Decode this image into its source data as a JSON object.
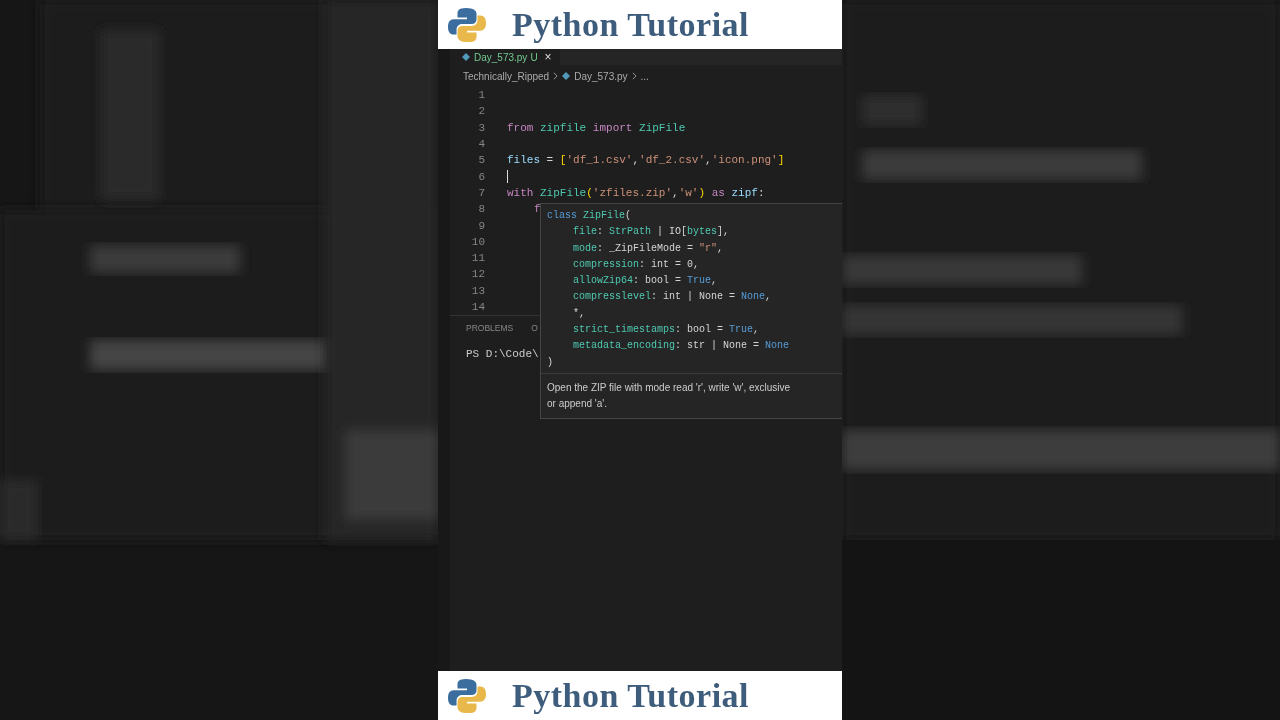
{
  "banner_top": {
    "title": "Python Tutorial"
  },
  "editor": {
    "tab": {
      "label": "Day_573.py",
      "status": "U",
      "close": "×",
      "selected": true
    },
    "breadcrumb": [
      "Technically_Ripped",
      "Day_573.py",
      "..."
    ],
    "lines": [
      {
        "number": "1"
      },
      {
        "number": "2"
      },
      {
        "number": "3",
        "tokens": [
          {
            "text": "from",
            "kind": "keyword"
          },
          {
            "text": " zipfile ",
            "kind": "module"
          },
          {
            "text": "import",
            "kind": "keyword"
          },
          {
            "text": " ZipFile",
            "kind": "module"
          }
        ]
      },
      {
        "number": "4"
      },
      {
        "number": "5",
        "tokens": [
          {
            "text": "files",
            "kind": "variable"
          },
          {
            "text": " = ",
            "kind": "plain"
          },
          {
            "text": "[",
            "kind": "bracket"
          },
          {
            "text": "'df_1.csv'",
            "kind": "string"
          },
          {
            "text": ",",
            "kind": "plain"
          },
          {
            "text": "'df_2.csv'",
            "kind": "string"
          },
          {
            "text": ",",
            "kind": "plain"
          },
          {
            "text": "'icon.png'",
            "kind": "string"
          },
          {
            "text": "]",
            "kind": "bracket"
          }
        ]
      },
      {
        "number": "6",
        "cursor": true
      },
      {
        "number": "7",
        "tokens": [
          {
            "text": "with",
            "kind": "keyword"
          },
          {
            "text": " ZipFile",
            "kind": "module"
          },
          {
            "text": "(",
            "kind": "bracket"
          },
          {
            "text": "'zfiles.zip'",
            "kind": "string"
          },
          {
            "text": ",",
            "kind": "plain"
          },
          {
            "text": "'w'",
            "kind": "string"
          },
          {
            "text": ")",
            "kind": "bracket"
          },
          {
            "text": " as ",
            "kind": "keyword"
          },
          {
            "text": "zipf",
            "kind": "variable"
          },
          {
            "text": ":",
            "kind": "plain"
          }
        ]
      },
      {
        "number": "8",
        "tokens": [
          {
            "text": "f",
            "kind": "keyword"
          }
        ],
        "indented": true
      },
      {
        "number": "9"
      },
      {
        "number": "10"
      },
      {
        "number": "11"
      },
      {
        "number": "12"
      },
      {
        "number": "13"
      },
      {
        "number": "14"
      }
    ]
  },
  "hover": {
    "signature_open": [
      {
        "text": "class",
        "kind": "storage"
      },
      {
        "text": " ZipFile",
        "kind": "module"
      },
      {
        "text": "(",
        "kind": "plain"
      }
    ],
    "parameters": [
      {
        "tokens": [
          {
            "text": "file",
            "kind": "param"
          },
          {
            "text": ": ",
            "kind": "plain"
          },
          {
            "text": "StrPath",
            "kind": "module"
          },
          {
            "text": " | IO[",
            "kind": "plain"
          },
          {
            "text": "bytes",
            "kind": "module"
          },
          {
            "text": "],",
            "kind": "plain"
          }
        ]
      },
      {
        "tokens": [
          {
            "text": "mode",
            "kind": "param"
          },
          {
            "text": ": ",
            "kind": "plain"
          },
          {
            "text": "_ZipFileMode",
            "kind": "plain"
          },
          {
            "text": " = ",
            "kind": "plain"
          },
          {
            "text": "\"r\"",
            "kind": "string"
          },
          {
            "text": ",",
            "kind": "plain"
          }
        ]
      },
      {
        "tokens": [
          {
            "text": "compression",
            "kind": "param"
          },
          {
            "text": ": int = 0,",
            "kind": "plain"
          }
        ]
      },
      {
        "tokens": [
          {
            "text": "allowZip64",
            "kind": "param"
          },
          {
            "text": ": bool = ",
            "kind": "plain"
          },
          {
            "text": "True",
            "kind": "constant"
          },
          {
            "text": ",",
            "kind": "plain"
          }
        ]
      },
      {
        "tokens": [
          {
            "text": "compresslevel",
            "kind": "param"
          },
          {
            "text": ": int | None = ",
            "kind": "plain"
          },
          {
            "text": "None",
            "kind": "constant"
          },
          {
            "text": ",",
            "kind": "plain"
          }
        ]
      },
      {
        "tokens": [
          {
            "text": "*,",
            "kind": "plain"
          }
        ]
      },
      {
        "tokens": [
          {
            "text": "strict_timestamps",
            "kind": "param"
          },
          {
            "text": ": bool = ",
            "kind": "plain"
          },
          {
            "text": "True",
            "kind": "constant"
          },
          {
            "text": ",",
            "kind": "plain"
          }
        ]
      },
      {
        "tokens": [
          {
            "text": "metadata_encoding",
            "kind": "param"
          },
          {
            "text": ": str | None = ",
            "kind": "plain"
          },
          {
            "text": "None",
            "kind": "constant"
          }
        ]
      }
    ],
    "signature_close": ")",
    "description": [
      "Open the ZIP file with mode read 'r', write 'w', exclusive",
      "or append 'a'."
    ]
  },
  "panel": {
    "tabs": [
      {
        "label": "PROBLEMS",
        "selected": false
      },
      {
        "label": "O",
        "selected": false
      }
    ],
    "terminal": "PS D:\\Code\\"
  },
  "banner_bottom": {
    "title": "Python Tutorial"
  }
}
